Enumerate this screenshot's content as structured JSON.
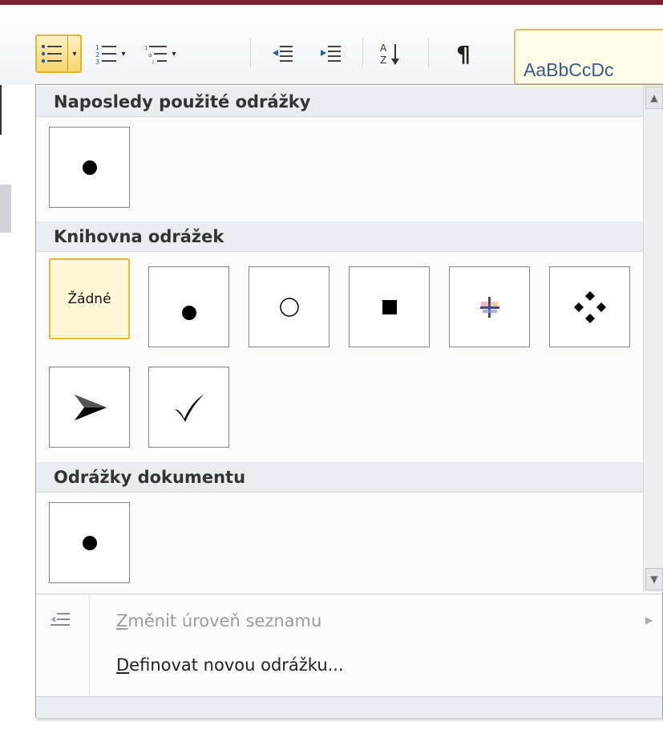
{
  "ribbon": {
    "style_preview": "AaBbCcDc"
  },
  "menu": {
    "recent_header": "Naposledy použité odrážky",
    "library_header": "Knihovna odrážek",
    "document_header": "Odrážky dokumentu",
    "library_items": [
      {
        "label": "Žádné",
        "selected": true
      },
      {
        "icon": "filled-circle-bullet-icon"
      },
      {
        "icon": "hollow-circle-bullet-icon"
      },
      {
        "icon": "square-bullet-icon"
      },
      {
        "icon": "cross-star-bullet-icon"
      },
      {
        "icon": "four-diamond-bullet-icon"
      },
      {
        "icon": "arrowhead-bullet-icon"
      },
      {
        "icon": "checkmark-bullet-icon"
      }
    ],
    "change_level": {
      "key": "Z",
      "rest": "měnit úroveň seznamu",
      "enabled": false
    },
    "define_new": {
      "key": "D",
      "rest": "efinovat novou odrážku..."
    }
  },
  "colors": {
    "selection_border": "#e6b93a",
    "selection_fill": "#fff7d6",
    "header_fill": "#e9ecf0"
  }
}
